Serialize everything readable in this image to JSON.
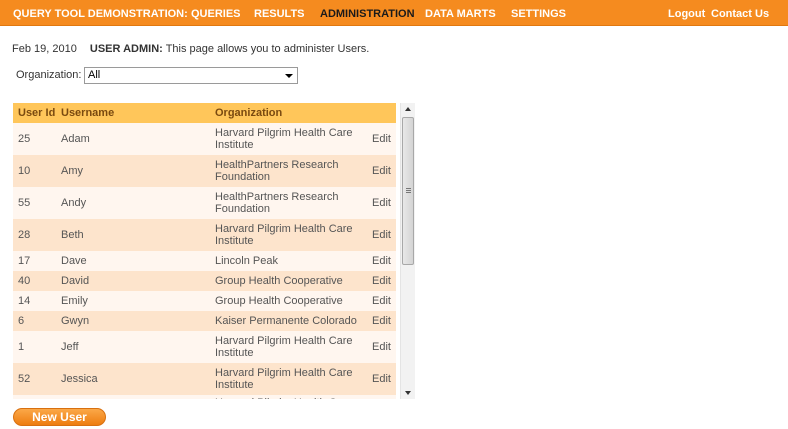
{
  "nav": {
    "brand": "QUERY TOOL DEMONSTRATION:",
    "items": [
      "QUERIES",
      "RESULTS",
      "ADMINISTRATION",
      "DATA MARTS",
      "SETTINGS"
    ],
    "active": "ADMINISTRATION",
    "right": [
      "Logout",
      "Contact Us"
    ]
  },
  "info": {
    "date": "Feb 19, 2010",
    "section": "USER ADMIN:",
    "description": "This page allows you to administer Users."
  },
  "filter": {
    "label": "Organization:",
    "value": "All"
  },
  "table": {
    "headers": [
      "User Id",
      "Username",
      "Organization"
    ],
    "edit_label": "Edit",
    "rows": [
      {
        "id": "25",
        "username": "Adam",
        "organization": "Harvard Pilgrim Health Care Institute"
      },
      {
        "id": "10",
        "username": "Amy",
        "organization": "HealthPartners Research Foundation"
      },
      {
        "id": "55",
        "username": "Andy",
        "organization": "HealthPartners Research Foundation"
      },
      {
        "id": "28",
        "username": "Beth",
        "organization": "Harvard Pilgrim Health Care Institute"
      },
      {
        "id": "17",
        "username": "Dave",
        "organization": "Lincoln Peak"
      },
      {
        "id": "40",
        "username": "David",
        "organization": "Group Health Cooperative"
      },
      {
        "id": "14",
        "username": "Emily",
        "organization": "Group Health Cooperative"
      },
      {
        "id": "6",
        "username": "Gwyn",
        "organization": "Kaiser Permanente Colorado"
      },
      {
        "id": "1",
        "username": "Jeff",
        "organization": "Harvard Pilgrim Health Care Institute"
      },
      {
        "id": "52",
        "username": "Jessica",
        "organization": "Harvard Pilgrim Health Care Institute"
      },
      {
        "id": "",
        "username": "",
        "organization": "Harvard Pilgrim Health Care"
      }
    ]
  },
  "new_user_label": "New User",
  "colors": {
    "nav_bg": "#f58b1f",
    "header_bg": "#ffc65a",
    "row_odd": "#fff6ef",
    "row_even": "#fde4cc",
    "button": "#ee7d10"
  }
}
